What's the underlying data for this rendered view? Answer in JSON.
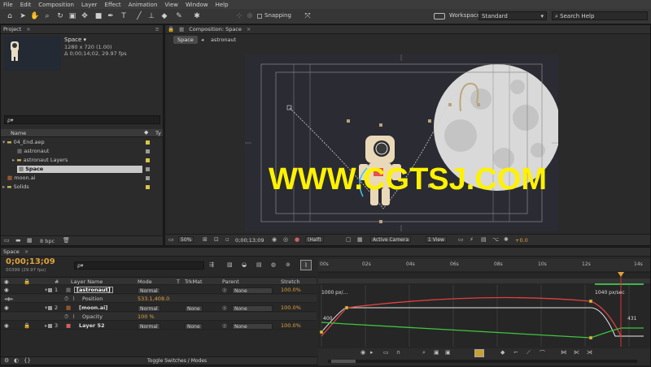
{
  "menu": [
    "File",
    "Edit",
    "Composition",
    "Layer",
    "Effect",
    "Animation",
    "View",
    "Window",
    "Help"
  ],
  "toolbar": {
    "snapping_label": "Snapping",
    "workspace_label": "Workspace:",
    "workspace_value": "Standard",
    "search_help_placeholder": "Search Help"
  },
  "project": {
    "tab": "Project",
    "comp_name": "Space ▾",
    "comp_size": "1280 x 720 (1.00)",
    "comp_duration": "Δ 0;00;14;02, 29.97 fps",
    "search_value": "ρ▾",
    "col_name": "Name",
    "col_type": "Ty",
    "items": [
      {
        "label": "04_End.aep",
        "depth": 0,
        "color": "#d6c64a"
      },
      {
        "label": "astronaut",
        "depth": 1,
        "color": "#9a9a9a"
      },
      {
        "label": "astronaut Layers",
        "depth": 1,
        "color": "#d6c64a"
      },
      {
        "label": "Space",
        "depth": 1,
        "color": "#9a9a9a"
      },
      {
        "label": "moon.ai",
        "depth": 0,
        "color": "#9a9a9a"
      },
      {
        "label": "Solids",
        "depth": 0,
        "color": "#d6c64a"
      }
    ],
    "bpc": "8 bpc"
  },
  "composition": {
    "tab": "Composition: Space",
    "breadcrumb_space": "Space",
    "breadcrumb_astronaut": "astronaut",
    "zoom": "50%",
    "timecode": "0;00;13;09",
    "resolution": "(Half)",
    "camera": "Active Camera",
    "views": "1 View",
    "exposure": "+0.0"
  },
  "watermark": "WWW.CGTSJ.COM",
  "timeline": {
    "tab": "Space",
    "current_time": "0;00;13;09",
    "frame_info": "00399 (29.97 fps)",
    "search_value": "ρ▾",
    "headers": {
      "num": "#",
      "layer_name": "Layer Name",
      "mode": "Mode",
      "t": "T",
      "trkmat": "TrkMat",
      "parent": "Parent",
      "stretch": "Stretch"
    },
    "layers": [
      {
        "num": "1",
        "name": "[astronaut]",
        "mode": "Normal",
        "trkmat": "",
        "parent": "None",
        "stretch": "100.0%"
      },
      {
        "num": "",
        "name": "Position",
        "mode": "533.1,408.0",
        "trkmat": "",
        "parent": "",
        "stretch": ""
      },
      {
        "num": "2",
        "name": "[moon.ai]",
        "mode": "Normal",
        "trkmat": "None",
        "parent": "None",
        "stretch": "100.0%"
      },
      {
        "num": "",
        "name": "Opacity",
        "mode": "100 %",
        "trkmat": "",
        "parent": "",
        "stretch": ""
      },
      {
        "num": "3",
        "name": "Layer 52",
        "mode": "Normal",
        "trkmat": "None",
        "parent": "None",
        "stretch": "100.0%"
      }
    ],
    "ruler_ticks": [
      "00s",
      "02s",
      "04s",
      "06s",
      "08s",
      "10s",
      "12s",
      "14s"
    ],
    "graph_top_label": "1000 px/...",
    "graph_right_label": "1040 px/sec",
    "graph_right_value": "431",
    "graph_left_value": "400",
    "toggle_label": "Toggle Switches / Modes"
  }
}
